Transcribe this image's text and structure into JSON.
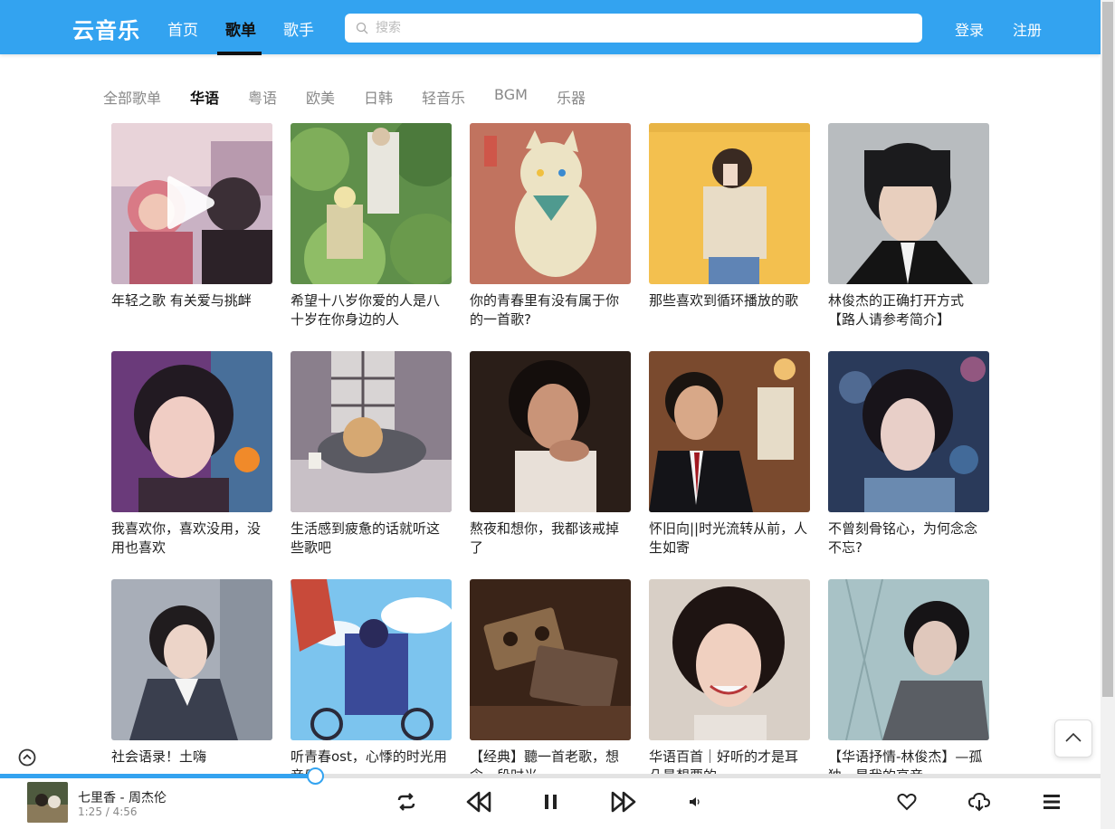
{
  "header": {
    "logo": "云音乐",
    "nav": [
      "首页",
      "歌单",
      "歌手"
    ],
    "active_nav": "歌单",
    "search_placeholder": "搜索",
    "login": "登录",
    "register": "注册"
  },
  "categories": {
    "items": [
      "全部歌单",
      "华语",
      "粤语",
      "欧美",
      "日韩",
      "轻音乐",
      "BGM",
      "乐器"
    ],
    "active": "华语"
  },
  "playlists": [
    {
      "title": "年轻之歌 有关爱与挑衅"
    },
    {
      "title": "希望十八岁你爱的人是八十岁在你身边的人"
    },
    {
      "title": "你的青春里有没有属于你的一首歌?"
    },
    {
      "title": "那些喜欢到循环播放的歌"
    },
    {
      "title": "林俊杰的正确打开方式【路人请参考简介】"
    },
    {
      "title": "我喜欢你，喜欢没用，没用也喜欢"
    },
    {
      "title": "生活感到疲惫的话就听这些歌吧"
    },
    {
      "title": "熬夜和想你，我都该戒掉了"
    },
    {
      "title": "怀旧向||时光流转从前，人生如寄"
    },
    {
      "title": "不曾刻骨铭心，为何念念不忘?"
    },
    {
      "title": "社会语录！土嗨"
    },
    {
      "title": "听青春ost，心悸的时光用音乐"
    },
    {
      "title": "【经典】聽一首老歌，想念一段时光"
    },
    {
      "title": "华语百首｜好听的才是耳朵最想要的"
    },
    {
      "title": "【华语抒情-林俊杰】—孤独，是我的高音"
    }
  ],
  "player": {
    "song": "七里香 - 周杰伦",
    "time": "1:25 / 4:56",
    "progress": 0.287
  },
  "colors": {
    "accent": "#33a3f0",
    "text_dark": "#111111",
    "text_muted": "#888888"
  },
  "icons": [
    "search-icon",
    "play-icon",
    "expand-up-icon",
    "back-to-top-icon",
    "loop-icon",
    "previous-icon",
    "pause-icon",
    "next-icon",
    "volume-icon",
    "heart-icon",
    "download-icon",
    "menu-icon"
  ]
}
